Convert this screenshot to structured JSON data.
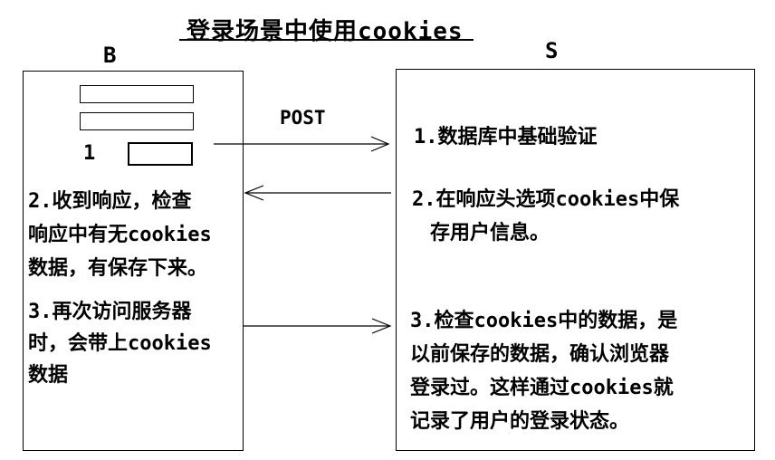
{
  "title": "登录场景中使用cookies",
  "browser": {
    "label": "B",
    "button_number": "1",
    "step2_lines": [
      "2.收到响应，检查",
      "响应中有无cookies",
      "数据，有保存下来。"
    ],
    "step3_lines": [
      "3.再次访问服务器",
      "时，会带上cookies",
      "数据"
    ]
  },
  "server": {
    "label": "S",
    "step1": "1.数据库中基础验证",
    "step2_lines": [
      "2.在响应头选项cookies中保",
      "存用户信息。"
    ],
    "step3_lines": [
      "3.检查cookies中的数据，是",
      "以前保存的数据，确认浏览器",
      "登录过。这样通过cookies就",
      "记录了用户的登录状态。"
    ]
  },
  "post_label": "POST"
}
